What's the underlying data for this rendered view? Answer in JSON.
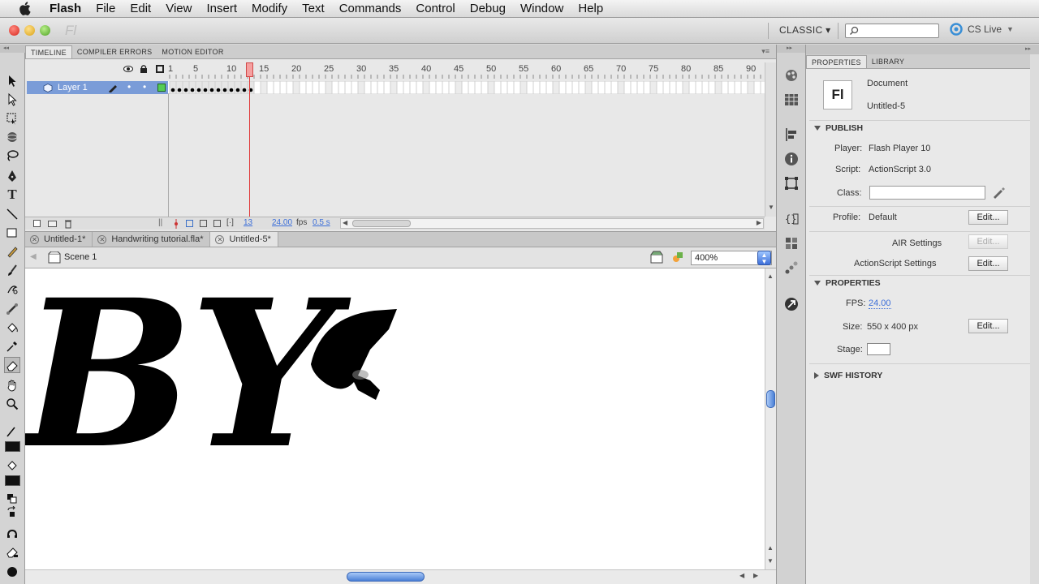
{
  "menubar": {
    "app": "Flash",
    "items": [
      "File",
      "Edit",
      "View",
      "Insert",
      "Modify",
      "Text",
      "Commands",
      "Control",
      "Debug",
      "Window",
      "Help"
    ]
  },
  "appbar": {
    "logo": "Fl",
    "workspace": "CLASSIC ▾",
    "cs_live": "CS Live"
  },
  "timeline": {
    "tabs": [
      "TIMELINE",
      "COMPILER ERRORS",
      "MOTION EDITOR"
    ],
    "ruler": [
      "1",
      "5",
      "10",
      "15",
      "20",
      "25",
      "30",
      "35",
      "40",
      "45",
      "50",
      "55",
      "60",
      "65",
      "70",
      "75",
      "80",
      "85",
      "90"
    ],
    "layer_name": "Layer 1",
    "current_frame": "13",
    "fps": "24.00",
    "fps_unit": "fps",
    "time": "0.5 s",
    "keyframes": 13
  },
  "doc_tabs": [
    "Untitled-1*",
    "Handwriting tutorial.fla*",
    "Untitled-5*"
  ],
  "edit_bar": {
    "scene": "Scene 1",
    "zoom": "400%"
  },
  "stage": {
    "text": "BY"
  },
  "properties": {
    "tabs": [
      "PROPERTIES",
      "LIBRARY"
    ],
    "doc_icon": "Fl",
    "doc_type": "Document",
    "doc_name": "Untitled-5",
    "publish_header": "PUBLISH",
    "player_label": "Player:",
    "player_value": "Flash Player 10",
    "script_label": "Script:",
    "script_value": "ActionScript 3.0",
    "class_label": "Class:",
    "profile_label": "Profile:",
    "profile_value": "Default",
    "edit": "Edit...",
    "air_settings": "AIR Settings",
    "as_settings": "ActionScript Settings",
    "properties_header": "PROPERTIES",
    "fps_label": "FPS:",
    "fps_value": "24.00",
    "size_label": "Size:",
    "size_value": "550 x 400 px",
    "stage_label": "Stage:",
    "swf_history": "SWF HISTORY"
  },
  "colors": {
    "layer_highlight": "#7a9cd8",
    "playhead": "#e03a3a",
    "selection_blue": "#3d6fd9"
  }
}
